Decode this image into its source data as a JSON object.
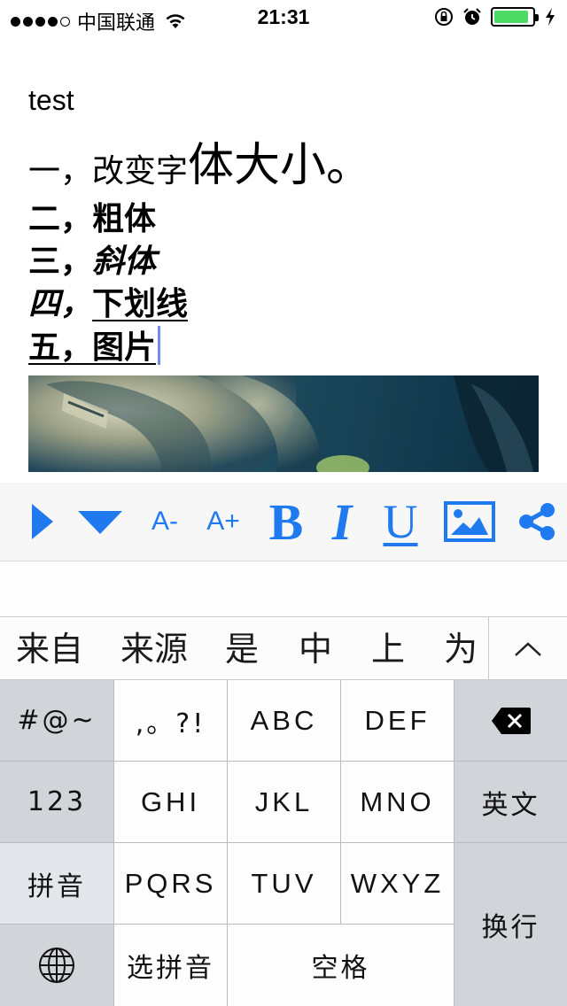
{
  "status_bar": {
    "carrier": "中国联通",
    "time": "21:31",
    "battery_level": 0.9
  },
  "editor": {
    "title": "test",
    "line1_small": "一，改变字",
    "line1_big": "体大小。",
    "line2": "二，粗体",
    "line3_prefix": "三，",
    "line3_italic": "斜体",
    "line4_prefix": "四，",
    "line4_underlined": "下划线",
    "line5": "五，图片"
  },
  "toolbar": {
    "font_smaller": "A-",
    "font_larger": "A+",
    "bold": "B",
    "italic": "I",
    "underline": "U",
    "accent_color": "#1f7af0"
  },
  "candidates": [
    "来自",
    "来源",
    "是",
    "中",
    "上",
    "为"
  ],
  "keyboard": {
    "symbols": "#@~",
    "punct": ",。?!",
    "abc": "ABC",
    "def": "DEF",
    "num": "123",
    "ghi": "GHI",
    "jkl": "JKL",
    "mno": "MNO",
    "english": "英文",
    "pinyin": "拼音",
    "pqrs": "PQRS",
    "tuv": "TUV",
    "wxyz": "WXYZ",
    "enter": "换行",
    "select_pinyin": "选拼音",
    "space": "空格"
  }
}
